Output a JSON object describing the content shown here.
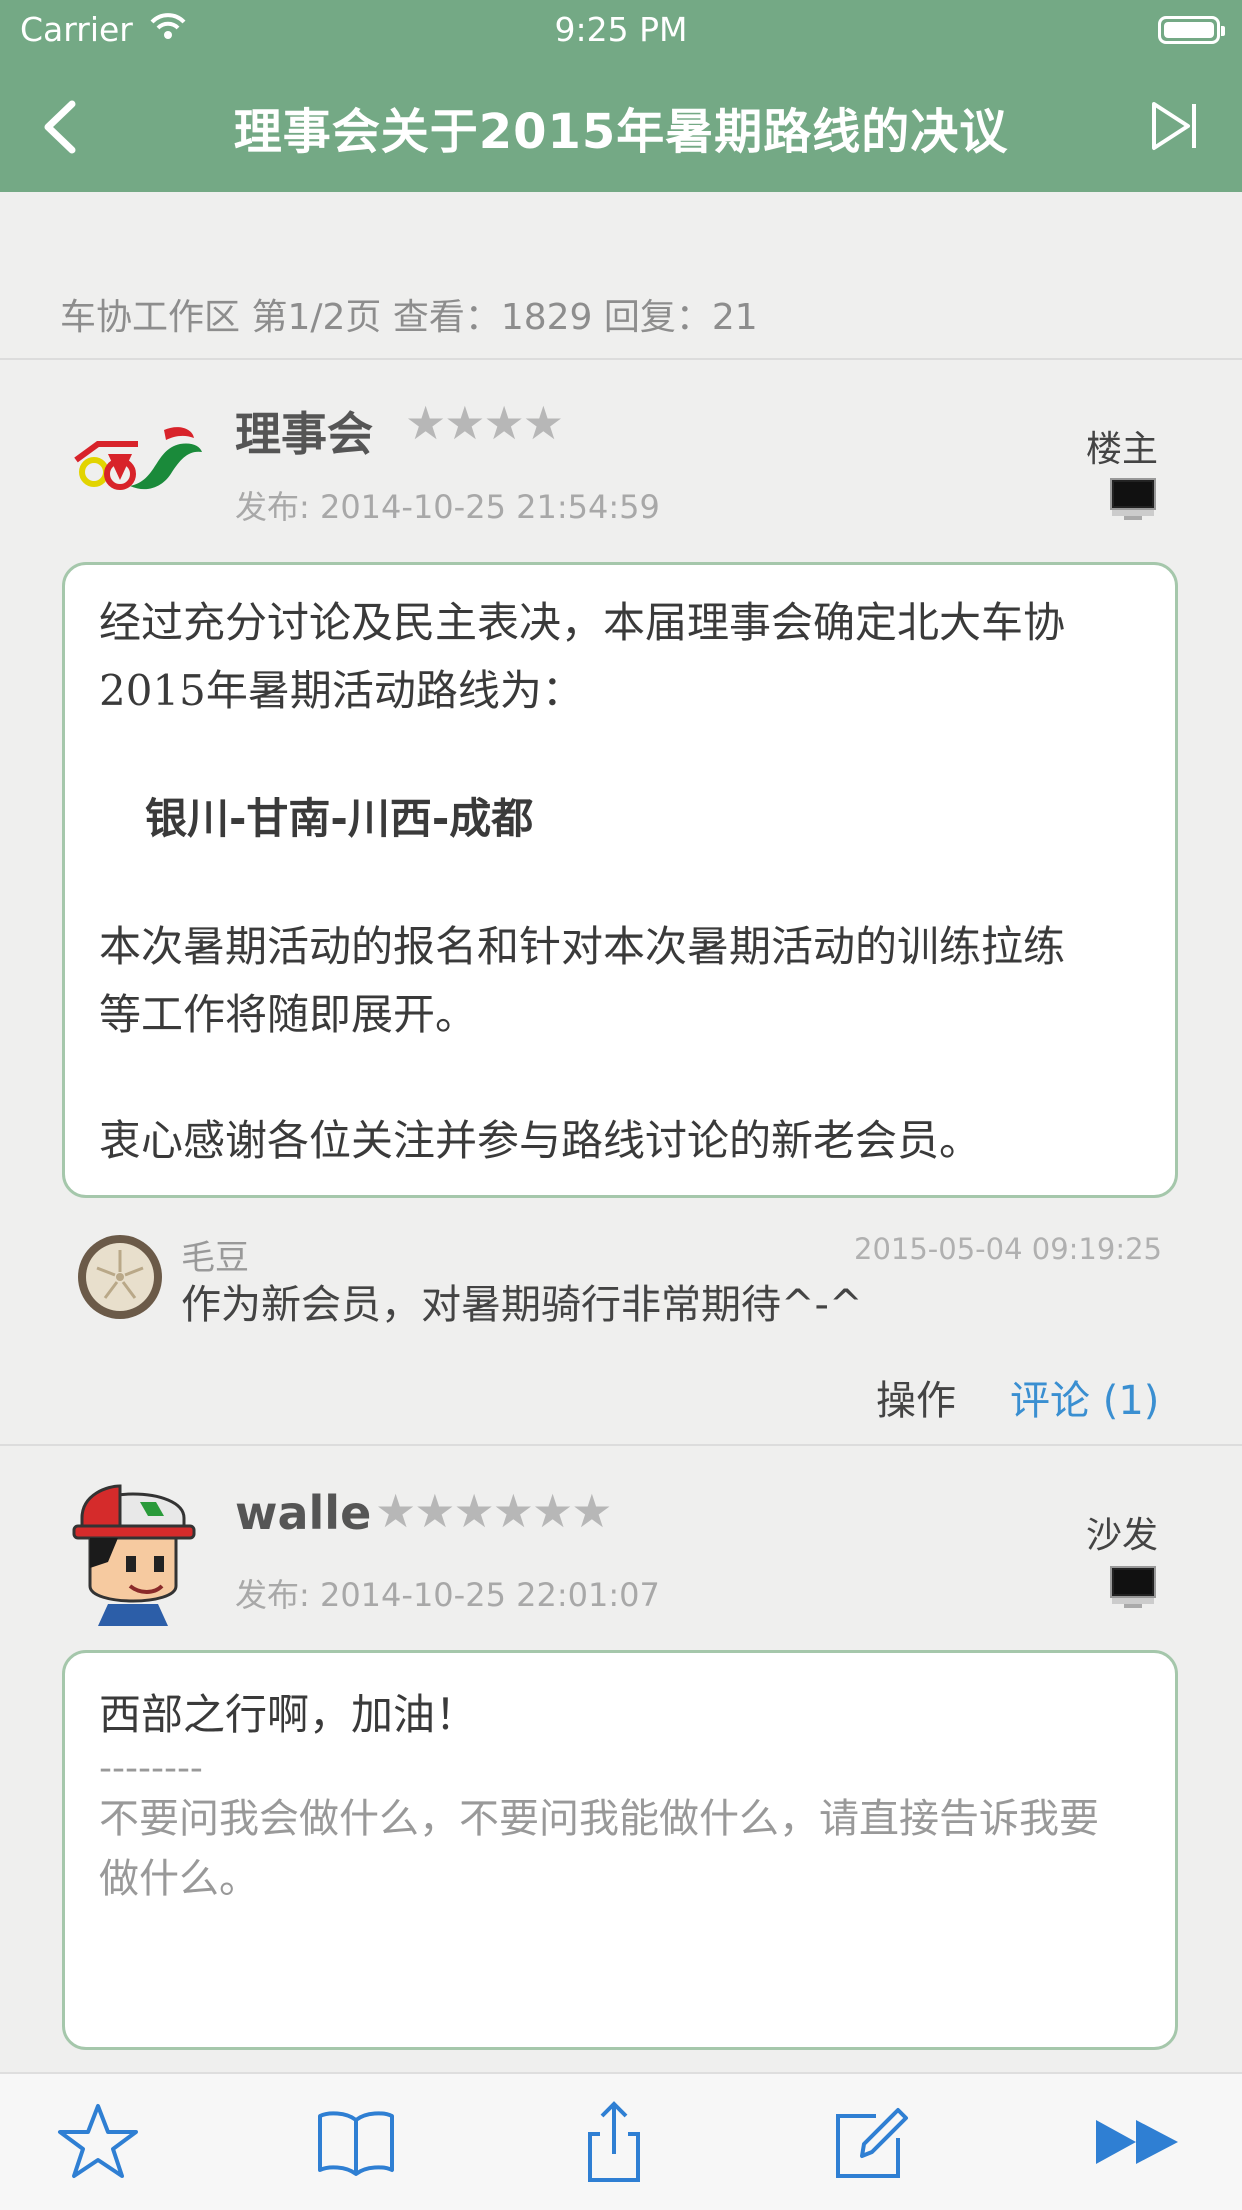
{
  "status_bar": {
    "carrier": "Carrier",
    "time": "9:25 PM"
  },
  "nav": {
    "title": "理事会关于2015年暑期路线的决议"
  },
  "thread_meta": "车协工作区 第1/2页 查看：1829 回复：21",
  "colors": {
    "nav_bg": "#74a985",
    "accent": "#3a8fd1",
    "box_border": "#a5c7ab"
  },
  "posts": [
    {
      "author": "理事会",
      "stars": "★★★★",
      "time": "发布: 2014-10-25 21:54:59",
      "floor": "楼主",
      "content": {
        "line1": "经过充分讨论及民主表决，本届理事会确定北大车协",
        "line2": "2015年暑期活动路线为：",
        "route": "银川-甘南-川西-成都",
        "line3": "本次暑期活动的报名和针对本次暑期活动的训练拉练",
        "line4": "等工作将随即展开。",
        "line5": "衷心感谢各位关注并参与路线讨论的新老会员。"
      },
      "comment": {
        "name": "毛豆",
        "time": "2015-05-04 09:19:25",
        "text": "作为新会员，对暑期骑行非常期待^-^"
      },
      "actions": {
        "operate": "操作",
        "comment": "评论 (1)"
      }
    },
    {
      "author": "walle",
      "stars": "★★★★★★",
      "time": "发布: 2014-10-25 22:01:07",
      "floor": "沙发",
      "content": {
        "line1": "西部之行啊，加油！",
        "sig_dash": "--------",
        "sig1": "不要问我会做什么，不要问我能做什么，请直接告诉我要",
        "sig2": "做什么。"
      }
    }
  ],
  "toolbar": [
    "star-icon",
    "book-icon",
    "share-icon",
    "compose-icon",
    "fast-forward-icon"
  ]
}
